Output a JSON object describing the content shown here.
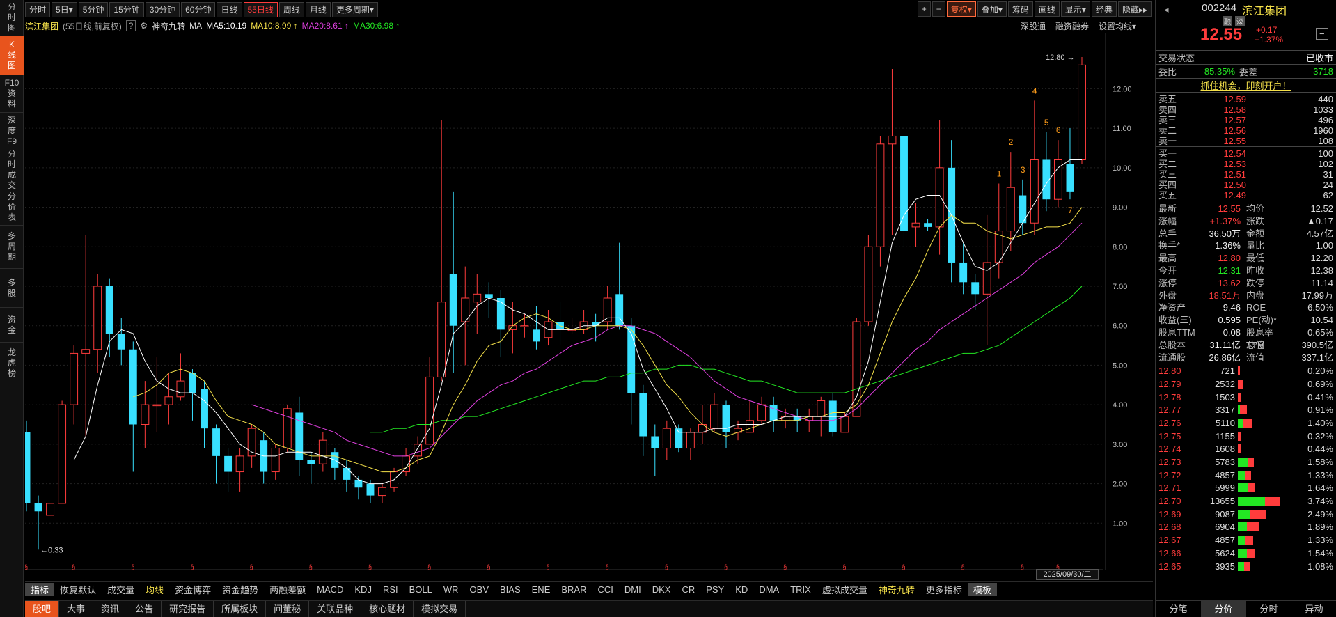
{
  "left_tabs": [
    {
      "label": "分时图"
    },
    {
      "label": "K线图",
      "active": true
    },
    {
      "label": "F10资料"
    },
    {
      "label": "深度F9"
    },
    {
      "label": "分时成交"
    },
    {
      "label": "分价表"
    },
    {
      "label": "多周期"
    },
    {
      "label": "多股"
    },
    {
      "label": "资金"
    },
    {
      "label": "龙虎榜"
    }
  ],
  "periods": [
    {
      "label": "分时"
    },
    {
      "label": "5日▾"
    },
    {
      "label": "5分钟"
    },
    {
      "label": "15分钟"
    },
    {
      "label": "30分钟"
    },
    {
      "label": "60分钟"
    },
    {
      "label": "日线"
    },
    {
      "label": "55日线",
      "active": true
    },
    {
      "label": "周线"
    },
    {
      "label": "月线"
    },
    {
      "label": "更多周期▾"
    }
  ],
  "toolbar_right": [
    {
      "label": "+"
    },
    {
      "label": "−"
    },
    {
      "label": "复权▾",
      "hl": true
    },
    {
      "label": "叠加▾"
    },
    {
      "label": "筹码"
    },
    {
      "label": "画线"
    },
    {
      "label": "显示▾"
    },
    {
      "label": "经典"
    },
    {
      "label": "隐藏▸▸"
    }
  ],
  "indicator": {
    "stock": "滨江集团",
    "desc": "(55日线,前复权)",
    "help": "?",
    "gear": "⚙",
    "jiuzhuan": "神奇九转",
    "ma": "MA",
    "ma5": "MA5:10.19",
    "ma10": "MA10:8.99 ↑",
    "ma20": "MA20:8.61 ↑",
    "ma30": "MA30:6.98 ↑",
    "links": [
      "深股通",
      "融资融券",
      "设置均线▾"
    ]
  },
  "colors": {
    "up": "#ff3c3c",
    "down": "#38e0ff",
    "ma5": "#ffffff",
    "ma10": "#f5e14a",
    "ma20": "#e040e0",
    "ma30": "#23e723"
  },
  "chart_data": {
    "type": "candlestick",
    "y_ticks": [
      "12.00",
      "11.00",
      "10.00",
      "9.00",
      "8.00",
      "7.00",
      "6.00",
      "5.00",
      "4.00",
      "3.00",
      "2.00",
      "1.00"
    ],
    "ylim": [
      0,
      13.4
    ],
    "max_label": "12.80",
    "min_label": "0.33",
    "candles": [
      [
        3.3,
        1.5,
        1.3,
        3.6
      ],
      [
        1.5,
        1.3,
        0.33,
        1.7
      ],
      [
        1.2,
        1.5,
        1.2,
        1.5
      ],
      [
        1.5,
        4.0,
        1.5,
        4.1
      ],
      [
        4.0,
        5.3,
        3.5,
        5.5
      ],
      [
        5.3,
        5.4,
        3.2,
        8.3
      ],
      [
        5.4,
        7.0,
        4.8,
        7.3
      ],
      [
        7.0,
        5.8,
        5.2,
        7.2
      ],
      [
        5.8,
        5.4,
        5.0,
        6.2
      ],
      [
        5.4,
        3.5,
        2.3,
        5.6
      ],
      [
        3.5,
        4.0,
        2.9,
        4.6
      ],
      [
        4.0,
        4.0,
        3.3,
        5.2
      ],
      [
        4.0,
        4.2,
        3.5,
        4.8
      ],
      [
        4.2,
        4.6,
        4.1,
        5.3
      ],
      [
        4.8,
        4.3,
        3.6,
        4.9
      ],
      [
        4.4,
        3.4,
        2.9,
        4.6
      ],
      [
        3.4,
        2.7,
        2.0,
        3.5
      ],
      [
        2.7,
        2.3,
        1.8,
        2.9
      ],
      [
        2.3,
        2.7,
        1.8,
        2.9
      ],
      [
        2.7,
        3.4,
        2.4,
        3.5
      ],
      [
        3.1,
        2.3,
        2.0,
        3.3
      ],
      [
        2.3,
        2.9,
        2.1,
        3.0
      ],
      [
        2.9,
        3.9,
        2.8,
        4.0
      ],
      [
        3.8,
        2.6,
        2.2,
        4.2
      ],
      [
        2.6,
        2.5,
        2.0,
        2.8
      ],
      [
        2.5,
        3.1,
        2.3,
        3.3
      ],
      [
        2.8,
        2.4,
        2.1,
        2.9
      ],
      [
        2.4,
        2.1,
        1.8,
        2.6
      ],
      [
        2.1,
        1.9,
        1.6,
        2.2
      ],
      [
        2.0,
        1.7,
        1.5,
        2.1
      ],
      [
        1.7,
        1.9,
        1.5,
        2.0
      ],
      [
        1.9,
        2.3,
        1.8,
        2.4
      ],
      [
        2.3,
        2.7,
        2.2,
        2.9
      ],
      [
        2.7,
        3.0,
        2.5,
        3.2
      ],
      [
        3.0,
        4.7,
        3.0,
        5.2
      ],
      [
        4.7,
        6.6,
        4.6,
        11.2
      ],
      [
        7.3,
        6.0,
        4.8,
        9.4
      ],
      [
        6.1,
        6.7,
        5.0,
        7.5
      ],
      [
        6.6,
        6.8,
        5.8,
        7.3
      ],
      [
        6.8,
        6.7,
        6.2,
        7.1
      ],
      [
        6.7,
        5.9,
        5.2,
        6.9
      ],
      [
        5.9,
        6.0,
        5.3,
        6.6
      ],
      [
        6.0,
        6.0,
        5.7,
        6.3
      ],
      [
        5.9,
        5.6,
        5.4,
        6.5
      ],
      [
        5.7,
        6.1,
        5.5,
        6.4
      ],
      [
        6.1,
        5.9,
        5.5,
        6.6
      ],
      [
        5.9,
        5.9,
        5.8,
        6.2
      ],
      [
        5.9,
        6.1,
        5.8,
        6.4
      ],
      [
        6.1,
        6.0,
        5.6,
        6.3
      ],
      [
        6.1,
        6.7,
        5.9,
        7.0
      ],
      [
        6.8,
        6.0,
        5.9,
        8.1
      ],
      [
        6.0,
        4.3,
        3.5,
        6.2
      ],
      [
        4.3,
        3.2,
        2.7,
        4.5
      ],
      [
        3.2,
        2.9,
        2.2,
        3.5
      ],
      [
        2.9,
        3.4,
        2.6,
        3.6
      ],
      [
        3.4,
        2.9,
        2.8,
        3.5
      ],
      [
        2.9,
        3.3,
        2.6,
        3.4
      ],
      [
        3.3,
        3.5,
        3.0,
        4.0
      ],
      [
        3.4,
        4.0,
        3.3,
        4.3
      ],
      [
        4.0,
        3.3,
        2.9,
        4.1
      ],
      [
        3.3,
        3.4,
        3.1,
        3.6
      ],
      [
        3.3,
        3.6,
        3.3,
        4.1
      ],
      [
        3.6,
        4.0,
        3.5,
        4.2
      ],
      [
        4.0,
        3.6,
        3.3,
        4.2
      ],
      [
        3.6,
        3.7,
        3.4,
        3.9
      ],
      [
        3.7,
        3.6,
        3.3,
        3.9
      ],
      [
        3.6,
        3.7,
        3.3,
        3.9
      ],
      [
        3.7,
        4.1,
        3.2,
        4.2
      ],
      [
        4.1,
        3.3,
        3.2,
        4.3
      ],
      [
        3.3,
        3.7,
        3.3,
        3.8
      ],
      [
        3.7,
        6.1,
        3.7,
        6.2
      ],
      [
        6.1,
        8.0,
        6.0,
        8.3
      ],
      [
        8.0,
        10.6,
        7.5,
        10.8
      ],
      [
        10.6,
        10.8,
        8.3,
        12.5
      ],
      [
        10.8,
        8.4,
        8.0,
        10.8
      ],
      [
        8.5,
        8.6,
        8.0,
        9.1
      ],
      [
        8.6,
        8.5,
        8.4,
        8.7
      ],
      [
        8.5,
        10.0,
        7.8,
        11.2
      ],
      [
        10.0,
        7.6,
        7.1,
        10.7
      ],
      [
        7.6,
        7.1,
        6.8,
        8.1
      ],
      [
        7.1,
        6.8,
        6.4,
        7.3
      ],
      [
        6.8,
        7.6,
        5.5,
        8.8
      ],
      [
        7.6,
        8.4,
        7.2,
        9.6
      ],
      [
        8.4,
        9.5,
        7.9,
        10.4
      ],
      [
        9.3,
        8.6,
        8.3,
        9.7
      ],
      [
        8.6,
        10.2,
        8.3,
        11.7
      ],
      [
        10.2,
        9.2,
        8.9,
        10.9
      ],
      [
        9.2,
        10.2,
        9.0,
        10.7
      ],
      [
        10.1,
        9.4,
        9.2,
        11.0
      ],
      [
        10.2,
        12.6,
        10.1,
        12.8
      ]
    ],
    "ma5": [
      null,
      null,
      null,
      null,
      2.6,
      3.2,
      4.5,
      5.6,
      5.9,
      5.8,
      5.1,
      4.6,
      4.4,
      4.3,
      4.3,
      4.1,
      3.8,
      3.4,
      3.0,
      2.8,
      2.7,
      2.7,
      2.8,
      2.8,
      2.8,
      2.7,
      2.6,
      2.4,
      2.1,
      2.0,
      2.0,
      2.1,
      2.4,
      2.9,
      3.4,
      4.5,
      5.8,
      6.1,
      6.5,
      6.7,
      6.6,
      6.4,
      6.3,
      6.1,
      5.9,
      5.9,
      5.9,
      6.0,
      6.0,
      6.2,
      6.2,
      5.8,
      4.9,
      4.4,
      3.9,
      3.3,
      3.3,
      3.3,
      3.4,
      3.4,
      3.5,
      3.5,
      3.5,
      3.6,
      3.7,
      3.7,
      3.7,
      3.7,
      3.7,
      3.7,
      4.2,
      5.1,
      6.6,
      8.1,
      8.8,
      9.2,
      9.3,
      9.3,
      8.8,
      8.1,
      7.5,
      7.4,
      7.6,
      8.1,
      8.6,
      9.1,
      9.6,
      10.0,
      10.2,
      10.2
    ]
  },
  "moving_averages": {
    "ma10": [
      null,
      null,
      null,
      null,
      null,
      null,
      null,
      null,
      null,
      4.2,
      4.3,
      4.5,
      4.8,
      4.9,
      4.8,
      4.6,
      4.1,
      3.7,
      3.6,
      3.5,
      3.3,
      3.0,
      2.9,
      2.8,
      2.7,
      2.7,
      2.7,
      2.6,
      2.5,
      2.4,
      2.3,
      2.3,
      2.4,
      2.6,
      2.7,
      3.3,
      4.0,
      4.5,
      5.1,
      5.5,
      5.6,
      6.0,
      6.2,
      6.3,
      6.2,
      6.0,
      5.9,
      5.9,
      6.0,
      6.0,
      6.0,
      5.9,
      5.5,
      5.0,
      4.5,
      4.2,
      3.8,
      3.5,
      3.3,
      3.2,
      3.3,
      3.4,
      3.5,
      3.6,
      3.6,
      3.6,
      3.7,
      3.7,
      3.8,
      3.8,
      4.0,
      4.5,
      5.3,
      6.1,
      6.7,
      7.2,
      7.9,
      8.5,
      8.8,
      8.6,
      8.6,
      8.4,
      8.3,
      8.2,
      8.3,
      8.4,
      8.5,
      8.5,
      8.6,
      9.0
    ],
    "ma20": [
      null,
      null,
      null,
      null,
      null,
      null,
      null,
      null,
      null,
      null,
      null,
      null,
      null,
      null,
      null,
      null,
      null,
      null,
      null,
      4.0,
      3.9,
      3.8,
      3.7,
      3.6,
      3.5,
      3.4,
      3.3,
      3.1,
      3.0,
      2.9,
      2.8,
      2.7,
      2.7,
      2.8,
      2.9,
      3.2,
      3.5,
      3.8,
      4.1,
      4.3,
      4.5,
      4.6,
      4.8,
      4.9,
      5.1,
      5.3,
      5.5,
      5.6,
      5.7,
      5.9,
      6.0,
      6.0,
      5.9,
      5.8,
      5.6,
      5.4,
      5.2,
      4.9,
      4.6,
      4.4,
      4.2,
      4.1,
      4.0,
      3.9,
      3.8,
      3.7,
      3.6,
      3.6,
      3.6,
      3.7,
      3.9,
      4.2,
      4.5,
      4.8,
      5.1,
      5.4,
      5.6,
      5.9,
      6.1,
      6.3,
      6.5,
      6.7,
      6.9,
      7.1,
      7.3,
      7.6,
      7.8,
      8.0,
      8.3,
      8.6
    ],
    "ma30": [
      null,
      null,
      null,
      null,
      null,
      null,
      null,
      null,
      null,
      null,
      null,
      null,
      null,
      null,
      null,
      null,
      null,
      null,
      null,
      null,
      null,
      null,
      null,
      null,
      null,
      null,
      null,
      null,
      null,
      3.3,
      3.3,
      3.4,
      3.4,
      3.5,
      3.5,
      3.6,
      3.6,
      3.7,
      3.7,
      3.8,
      3.9,
      4.0,
      4.1,
      4.2,
      4.3,
      4.4,
      4.5,
      4.6,
      4.6,
      4.7,
      4.7,
      4.8,
      4.8,
      4.9,
      4.9,
      5.0,
      5.0,
      4.9,
      4.9,
      4.8,
      4.7,
      4.6,
      4.6,
      4.5,
      4.4,
      4.3,
      4.3,
      4.3,
      4.3,
      4.3,
      4.4,
      4.5,
      4.6,
      4.7,
      4.8,
      4.9,
      5.0,
      5.1,
      5.2,
      5.3,
      5.3,
      5.4,
      5.5,
      5.7,
      5.9,
      6.1,
      6.3,
      6.5,
      6.7,
      7.0
    ]
  },
  "nine_labels": [
    {
      "i": 82,
      "t": "1"
    },
    {
      "i": 83,
      "t": "2"
    },
    {
      "i": 84,
      "t": "3"
    },
    {
      "i": 85,
      "t": "4"
    },
    {
      "i": 86,
      "t": "5"
    },
    {
      "i": 87,
      "t": "6"
    },
    {
      "i": 88,
      "t": "7"
    }
  ],
  "date_label": "2025/09/30/二",
  "indicator_tabs": [
    {
      "label": "指标",
      "active": true
    },
    {
      "label": "恢复默认"
    },
    {
      "label": "成交量"
    },
    {
      "label": "均线",
      "yellow": true
    },
    {
      "label": "资金博弈"
    },
    {
      "label": "资金趋势"
    },
    {
      "label": "两融差额"
    },
    {
      "label": "MACD"
    },
    {
      "label": "KDJ"
    },
    {
      "label": "RSI"
    },
    {
      "label": "BOLL"
    },
    {
      "label": "WR"
    },
    {
      "label": "OBV"
    },
    {
      "label": "BIAS"
    },
    {
      "label": "ENE"
    },
    {
      "label": "BRAR"
    },
    {
      "label": "CCI"
    },
    {
      "label": "DMI"
    },
    {
      "label": "DKX"
    },
    {
      "label": "CR"
    },
    {
      "label": "PSY"
    },
    {
      "label": "KD"
    },
    {
      "label": "DMA"
    },
    {
      "label": "TRIX"
    },
    {
      "label": "虚拟成交量"
    },
    {
      "label": "神奇九转",
      "yellow": true
    },
    {
      "label": "更多指标"
    },
    {
      "label": "模板",
      "active": true
    }
  ],
  "bottom_nav": [
    {
      "label": "股吧",
      "active": true
    },
    {
      "label": "大事"
    },
    {
      "label": "资讯"
    },
    {
      "label": "公告"
    },
    {
      "label": "研究报告"
    },
    {
      "label": "所属板块"
    },
    {
      "label": "间董秘"
    },
    {
      "label": "关联品种"
    },
    {
      "label": "核心题材"
    },
    {
      "label": "模拟交易"
    }
  ],
  "quote": {
    "code": "002244",
    "name": "滨江集团",
    "tag1": "融",
    "tag2": "深",
    "price": "12.55",
    "change": "+0.17",
    "pct": "+1.37%",
    "minus": "−",
    "status_label": "交易状态",
    "status": "已收市",
    "weibi_label": "委比",
    "weibi": "-85.35%",
    "weicha_label": "委差",
    "weicha": "-3718",
    "promo": "抓住机会，即刻开户！",
    "asks": [
      {
        "l": "卖五",
        "p": "12.59",
        "v": "440"
      },
      {
        "l": "卖四",
        "p": "12.58",
        "v": "1033"
      },
      {
        "l": "卖三",
        "p": "12.57",
        "v": "496"
      },
      {
        "l": "卖二",
        "p": "12.56",
        "v": "1960"
      },
      {
        "l": "卖一",
        "p": "12.55",
        "v": "108"
      }
    ],
    "bids": [
      {
        "l": "买一",
        "p": "12.54",
        "v": "100"
      },
      {
        "l": "买二",
        "p": "12.53",
        "v": "102"
      },
      {
        "l": "买三",
        "p": "12.51",
        "v": "31"
      },
      {
        "l": "买四",
        "p": "12.50",
        "v": "24"
      },
      {
        "l": "买五",
        "p": "12.49",
        "v": "62"
      }
    ],
    "stats": [
      {
        "a": "最新",
        "av": "12.55",
        "ac": "red",
        "b": "均价",
        "bv": "12.52",
        "bc": "red"
      },
      {
        "a": "涨幅",
        "av": "+1.37%",
        "ac": "red",
        "b": "涨跌",
        "bv": "▲0.17",
        "bc": "red"
      },
      {
        "a": "总手",
        "av": "36.50万",
        "ac": "white",
        "b": "金额",
        "bv": "4.57亿",
        "bc": "cyan"
      },
      {
        "a": "换手*",
        "av": "1.36%",
        "ac": "white",
        "b": "量比",
        "bv": "1.00",
        "bc": "white"
      },
      {
        "a": "最高",
        "av": "12.80",
        "ac": "red",
        "b": "最低",
        "bv": "12.20",
        "bc": "green"
      },
      {
        "a": "今开",
        "av": "12.31",
        "ac": "green",
        "b": "昨收",
        "bv": "12.38",
        "bc": "white"
      },
      {
        "a": "涨停",
        "av": "13.62",
        "ac": "red",
        "b": "跌停",
        "bv": "11.14",
        "bc": "green"
      },
      {
        "a": "外盘",
        "av": "18.51万",
        "ac": "red",
        "b": "内盘",
        "bv": "17.99万",
        "bc": "green"
      },
      {
        "a": "净资产",
        "av": "9.46",
        "ac": "white",
        "b": "ROE",
        "bv": "6.50%",
        "bc": "white"
      },
      {
        "a": "收益(三)",
        "av": "0.595",
        "ac": "white",
        "b": "PE(动)*",
        "bv": "10.54",
        "bc": "white"
      },
      {
        "a": "股息TTM",
        "av": "0.08",
        "ac": "white",
        "b": "股息率TTM",
        "bv": "0.65%",
        "bc": "white"
      },
      {
        "a": "总股本",
        "av": "31.11亿",
        "ac": "white",
        "b": "总值",
        "bv": "390.5亿",
        "bc": "white"
      },
      {
        "a": "流通股",
        "av": "26.86亿",
        "ac": "white",
        "b": "流值",
        "bv": "337.1亿",
        "bc": "white"
      }
    ],
    "dist": [
      {
        "p": "12.80",
        "v": "721",
        "pct": "0.20%",
        "r": 0.05,
        "g": 0.0
      },
      {
        "p": "12.79",
        "v": "2532",
        "pct": "0.69%",
        "r": 0.12,
        "g": 0.0
      },
      {
        "p": "12.78",
        "v": "1503",
        "pct": "0.41%",
        "r": 0.09,
        "g": 0.0
      },
      {
        "p": "12.77",
        "v": "3317",
        "pct": "0.91%",
        "r": 0.16,
        "g": 0.05
      },
      {
        "p": "12.76",
        "v": "5110",
        "pct": "1.40%",
        "r": 0.2,
        "g": 0.14
      },
      {
        "p": "12.75",
        "v": "1155",
        "pct": "0.32%",
        "r": 0.06,
        "g": 0.0
      },
      {
        "p": "12.74",
        "v": "1608",
        "pct": "0.44%",
        "r": 0.08,
        "g": 0.0
      },
      {
        "p": "12.73",
        "v": "5783",
        "pct": "1.58%",
        "r": 0.14,
        "g": 0.24
      },
      {
        "p": "12.72",
        "v": "4857",
        "pct": "1.33%",
        "r": 0.12,
        "g": 0.19
      },
      {
        "p": "12.71",
        "v": "5999",
        "pct": "1.64%",
        "r": 0.16,
        "g": 0.24
      },
      {
        "p": "12.70",
        "v": "13655",
        "pct": "3.74%",
        "r": 0.35,
        "g": 0.65
      },
      {
        "p": "12.69",
        "v": "9087",
        "pct": "2.49%",
        "r": 0.38,
        "g": 0.29
      },
      {
        "p": "12.68",
        "v": "6904",
        "pct": "1.89%",
        "r": 0.28,
        "g": 0.22
      },
      {
        "p": "12.67",
        "v": "4857",
        "pct": "1.33%",
        "r": 0.17,
        "g": 0.19
      },
      {
        "p": "12.66",
        "v": "5624",
        "pct": "1.54%",
        "r": 0.2,
        "g": 0.21
      },
      {
        "p": "12.65",
        "v": "3935",
        "pct": "1.08%",
        "r": 0.13,
        "g": 0.15
      }
    ],
    "tabs": [
      {
        "label": "分笔"
      },
      {
        "label": "分价",
        "active": true
      },
      {
        "label": "分时"
      },
      {
        "label": "异动"
      }
    ]
  }
}
